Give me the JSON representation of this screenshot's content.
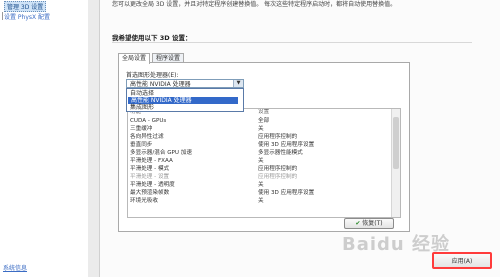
{
  "nav": {
    "items": [
      {
        "label": "管理 3D 设置"
      },
      {
        "label": "设置 PhysX 配置"
      }
    ],
    "system_info": "系统信息"
  },
  "description": "您可以更改全局 3D 设置，并且对特定程序创建替换值。 每次这些特定程序启动时，都将自动使用替换值。",
  "section_title": "我希望使用以下 3D 设置：",
  "tabs": [
    {
      "label": "全局设置",
      "active": true
    },
    {
      "label": "程序设置",
      "active": false
    }
  ],
  "preferred_gpu": {
    "label": "首选图形处理器(E):",
    "selected": "高性能 NVIDIA 处理器",
    "options": [
      "自动选择",
      "高性能 NVIDIA 处理器",
      "集成图形"
    ],
    "highlighted_index": 1
  },
  "grid": {
    "header_feature": "功能",
    "header_setting": "设置",
    "rows": [
      {
        "feature": "CUDA - GPUs",
        "setting": "全部",
        "dim": false
      },
      {
        "feature": "三重缓冲",
        "setting": "关",
        "dim": false
      },
      {
        "feature": "各向异性过滤",
        "setting": "应用程序控制的",
        "dim": false
      },
      {
        "feature": "垂直同步",
        "setting": "使用 3D 应用程序设置",
        "dim": false
      },
      {
        "feature": "多显示器/混合 GPU 加速",
        "setting": "多显示器性能模式",
        "dim": false
      },
      {
        "feature": "平滑处理 - FXAA",
        "setting": "关",
        "dim": false
      },
      {
        "feature": "平滑处理 - 模式",
        "setting": "应用程序控制的",
        "dim": false
      },
      {
        "feature": "平滑处理 - 设置",
        "setting": "应用程序控制的",
        "dim": true
      },
      {
        "feature": "平滑处理 - 透明度",
        "setting": "关",
        "dim": false
      },
      {
        "feature": "最大预渲染帧数",
        "setting": "使用 3D 应用程序设置",
        "dim": false
      },
      {
        "feature": "环境光吸收",
        "setting": "关",
        "dim": false
      }
    ]
  },
  "buttons": {
    "restore": "恢复(T)",
    "apply": "应用(A)"
  },
  "watermark": "Baidu 经验",
  "colors": {
    "selection_blue": "#3369c9",
    "apply_highlight": "#ff3b3b"
  }
}
